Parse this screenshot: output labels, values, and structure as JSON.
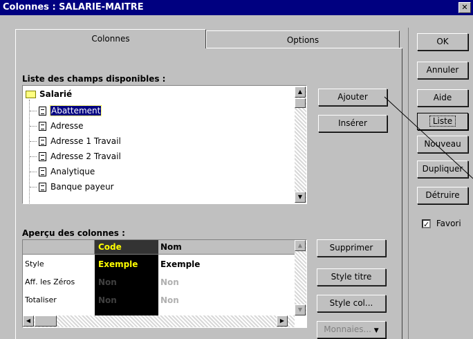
{
  "window": {
    "title": "Colonnes : SALARIE-MAITRE",
    "close_glyph": "✕"
  },
  "tabs": [
    {
      "label": "Colonnes"
    },
    {
      "label": "Options"
    }
  ],
  "fields": {
    "label": "Liste des champs disponibles :",
    "root": "Salarié",
    "items": [
      "Abattement",
      "Adresse",
      "Adresse 1 Travail",
      "Adresse 2 Travail",
      "Analytique",
      "Banque payeur"
    ],
    "selected": "Abattement"
  },
  "actions": {
    "ajouter": "Ajouter",
    "inserer": "Insérer"
  },
  "right_buttons": {
    "ok": "OK",
    "annuler": "Annuler",
    "aide": "Aide",
    "liste": "Liste",
    "nouveau": "Nouveau",
    "dupliquer": "Dupliquer",
    "detruire": "Détruire"
  },
  "favori": {
    "label": "Favori",
    "checked": true
  },
  "preview": {
    "label": "Aperçu des colonnes :",
    "columns": [
      "Code",
      "Nom"
    ],
    "rows": [
      {
        "label": "Style",
        "values": [
          "Exemple",
          "Exemple"
        ]
      },
      {
        "label": "Aff. les Zéros",
        "values": [
          "Non",
          "Non"
        ]
      },
      {
        "label": "Totaliser",
        "values": [
          "Non",
          "Non"
        ]
      }
    ]
  },
  "preview_buttons": {
    "supprimer": "Supprimer",
    "style_titre": "Style titre",
    "style_col": "Style col...",
    "monnaies": "Monnaies..."
  },
  "colors": {
    "titlebar": "#000080",
    "selection": "#000080",
    "code_header": "#333333",
    "code_text": "#ffff00"
  }
}
